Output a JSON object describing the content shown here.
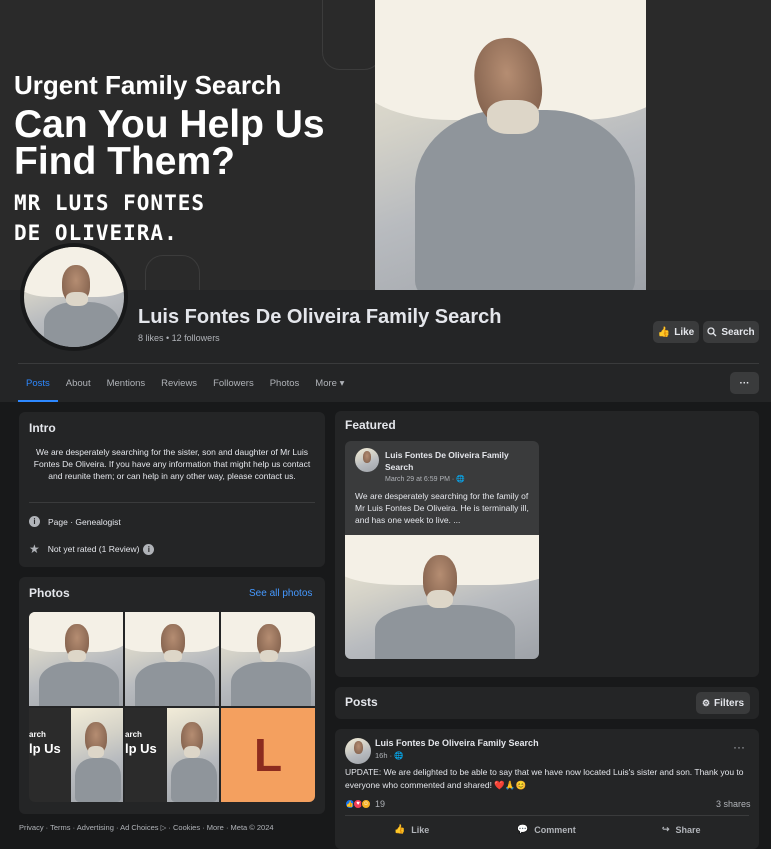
{
  "cover": {
    "line1": "Urgent Family Search",
    "line2": "Can You Help Us Find Them?",
    "line3": "MR LUIS FONTES\nDE OLIVEIRA."
  },
  "page": {
    "title": "Luis Fontes De Oliveira Family Search",
    "stats": "8 likes • 12 followers",
    "like_label": "Like",
    "search_label": "Search"
  },
  "tabs": [
    {
      "label": "Posts",
      "active": true
    },
    {
      "label": "About"
    },
    {
      "label": "Mentions"
    },
    {
      "label": "Reviews"
    },
    {
      "label": "Followers"
    },
    {
      "label": "Photos"
    },
    {
      "label": "More ▾"
    }
  ],
  "more_button": "···",
  "intro": {
    "title": "Intro",
    "text": "We are desperately searching for the sister, son and daughter of Mr Luis Fontes De Oliveira. If you have any information that might help us contact and reunite them; or can help in any other way, please contact us.",
    "category": "Page · Genealogist",
    "rating": "Not yet rated (1 Review)"
  },
  "photos": {
    "title": "Photos",
    "see_all": "See all photos",
    "tile_text_a": "arch",
    "tile_text_b": "lp Us",
    "letter_tile": "L"
  },
  "footer": "Privacy · Terms · Advertising · Ad Choices ▷ · Cookies · More · Meta © 2024",
  "featured": {
    "title": "Featured",
    "author": "Luis Fontes De Oliveira Family Search",
    "date": "March 29 at 6:59 PM · 🌐",
    "text": "We are desperately searching for the family of Mr Luis Fontes De Oliveira. He is terminally ill, and has one week to live. ..."
  },
  "posts": {
    "title": "Posts",
    "filters_label": "Filters",
    "items": [
      {
        "author": "Luis Fontes De Oliveira Family Search",
        "time": "16h · 🌐",
        "text": "UPDATE:  We are delighted to be able to say that we have now located Luis's sister and son. Thank you to everyone who commented and shared! ❤️🙏😊",
        "reactions_count": "19",
        "shares": "3 shares",
        "like": "Like",
        "comment": "Comment",
        "share": "Share"
      }
    ]
  },
  "colors": {
    "accent": "#2d88ff",
    "card": "#242526",
    "background": "#18191a"
  }
}
